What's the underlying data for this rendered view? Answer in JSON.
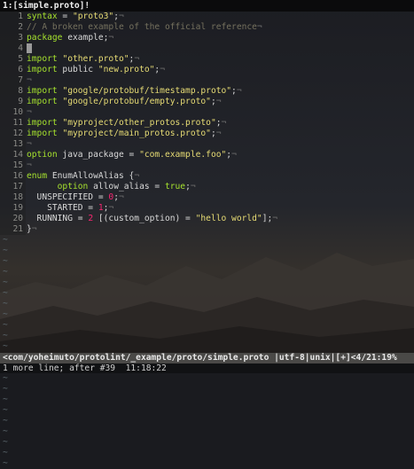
{
  "tab": {
    "label": "1:[simple.proto]!"
  },
  "lines": [
    {
      "n": "1",
      "parts": [
        {
          "t": "syntax",
          "c": "kw"
        },
        {
          "t": " = ",
          "c": ""
        },
        {
          "t": "\"proto3\"",
          "c": "str"
        },
        {
          "t": ";",
          "c": ""
        },
        {
          "t": "¬",
          "c": "tl"
        }
      ]
    },
    {
      "n": "2",
      "parts": [
        {
          "t": "// A broken example of the official reference",
          "c": "cm"
        },
        {
          "t": "¬",
          "c": "tl"
        }
      ]
    },
    {
      "n": "3",
      "parts": [
        {
          "t": "package",
          "c": "kw"
        },
        {
          "t": " example;",
          "c": ""
        },
        {
          "t": "¬",
          "c": "tl"
        }
      ]
    },
    {
      "n": "4",
      "parts": [],
      "cursor": true
    },
    {
      "n": "5",
      "parts": [
        {
          "t": "import",
          "c": "kw"
        },
        {
          "t": " ",
          "c": ""
        },
        {
          "t": "\"other.proto\"",
          "c": "str"
        },
        {
          "t": ";",
          "c": ""
        },
        {
          "t": "¬",
          "c": "tl"
        }
      ]
    },
    {
      "n": "6",
      "parts": [
        {
          "t": "import",
          "c": "kw"
        },
        {
          "t": " public ",
          "c": ""
        },
        {
          "t": "\"new.proto\"",
          "c": "str"
        },
        {
          "t": ";",
          "c": ""
        },
        {
          "t": "¬",
          "c": "tl"
        }
      ]
    },
    {
      "n": "7",
      "parts": [
        {
          "t": "¬",
          "c": "tl"
        }
      ]
    },
    {
      "n": "8",
      "parts": [
        {
          "t": "import",
          "c": "kw"
        },
        {
          "t": " ",
          "c": ""
        },
        {
          "t": "\"google/protobuf/timestamp.proto\"",
          "c": "str"
        },
        {
          "t": ";",
          "c": ""
        },
        {
          "t": "¬",
          "c": "tl"
        }
      ]
    },
    {
      "n": "9",
      "parts": [
        {
          "t": "import",
          "c": "kw"
        },
        {
          "t": " ",
          "c": ""
        },
        {
          "t": "\"google/protobuf/empty.proto\"",
          "c": "str"
        },
        {
          "t": ";",
          "c": ""
        },
        {
          "t": "¬",
          "c": "tl"
        }
      ]
    },
    {
      "n": "10",
      "parts": [
        {
          "t": "¬",
          "c": "tl"
        }
      ]
    },
    {
      "n": "11",
      "parts": [
        {
          "t": "import",
          "c": "kw"
        },
        {
          "t": " ",
          "c": ""
        },
        {
          "t": "\"myproject/other_protos.proto\"",
          "c": "str"
        },
        {
          "t": ";",
          "c": ""
        },
        {
          "t": "¬",
          "c": "tl"
        }
      ]
    },
    {
      "n": "12",
      "parts": [
        {
          "t": "import",
          "c": "kw"
        },
        {
          "t": " ",
          "c": ""
        },
        {
          "t": "\"myproject/main_protos.proto\"",
          "c": "str"
        },
        {
          "t": ";",
          "c": ""
        },
        {
          "t": "¬",
          "c": "tl"
        }
      ]
    },
    {
      "n": "13",
      "parts": [
        {
          "t": "¬",
          "c": "tl"
        }
      ]
    },
    {
      "n": "14",
      "parts": [
        {
          "t": "option",
          "c": "kw"
        },
        {
          "t": " java_package = ",
          "c": ""
        },
        {
          "t": "\"com.example.foo\"",
          "c": "str"
        },
        {
          "t": ";",
          "c": ""
        },
        {
          "t": "¬",
          "c": "tl"
        }
      ]
    },
    {
      "n": "15",
      "parts": [
        {
          "t": "¬",
          "c": "tl"
        }
      ]
    },
    {
      "n": "16",
      "parts": [
        {
          "t": "enum",
          "c": "kw"
        },
        {
          "t": " EnumAllowAlias {",
          "c": ""
        },
        {
          "t": "¬",
          "c": "tl"
        }
      ]
    },
    {
      "n": "17",
      "parts": [
        {
          "t": "      ",
          "c": ""
        },
        {
          "t": "option",
          "c": "kw"
        },
        {
          "t": " allow_alias = ",
          "c": ""
        },
        {
          "t": "true",
          "c": "kw"
        },
        {
          "t": ";",
          "c": ""
        },
        {
          "t": "¬",
          "c": "tl"
        }
      ]
    },
    {
      "n": "18",
      "parts": [
        {
          "t": "  UNSPECIFIED = ",
          "c": ""
        },
        {
          "t": "0",
          "c": "pn"
        },
        {
          "t": ";",
          "c": ""
        },
        {
          "t": "¬",
          "c": "tl"
        }
      ]
    },
    {
      "n": "19",
      "parts": [
        {
          "t": "    STARTED = ",
          "c": ""
        },
        {
          "t": "1",
          "c": "pn"
        },
        {
          "t": ";",
          "c": ""
        },
        {
          "t": "¬",
          "c": "tl"
        }
      ]
    },
    {
      "n": "20",
      "parts": [
        {
          "t": "  RUNNING = ",
          "c": ""
        },
        {
          "t": "2",
          "c": "pn"
        },
        {
          "t": " [(custom_option) = ",
          "c": ""
        },
        {
          "t": "\"hello world\"",
          "c": "str"
        },
        {
          "t": "];",
          "c": ""
        },
        {
          "t": "¬",
          "c": "tl"
        }
      ]
    },
    {
      "n": "21",
      "parts": [
        {
          "t": "}",
          "c": ""
        },
        {
          "t": "¬",
          "c": "tl"
        }
      ]
    }
  ],
  "tildes": [
    "~",
    "~",
    "~",
    "~",
    "~",
    "~",
    "~",
    "~",
    "~",
    "~",
    "~",
    "~",
    "~",
    "~",
    "~",
    "~",
    "~",
    "~",
    "~",
    "~",
    "~",
    "~"
  ],
  "statusline": {
    "text": "<com/yoheimuto/protolint/_example/proto/simple.proto |utf-8|unix|[+]<4/21:19%"
  },
  "cmdline": {
    "text": "1 more line; after #39  11:18:22"
  },
  "colors": {
    "keyword": "#a6e22e",
    "string": "#e6db74",
    "comment": "#75715e",
    "number": "#f92672"
  }
}
